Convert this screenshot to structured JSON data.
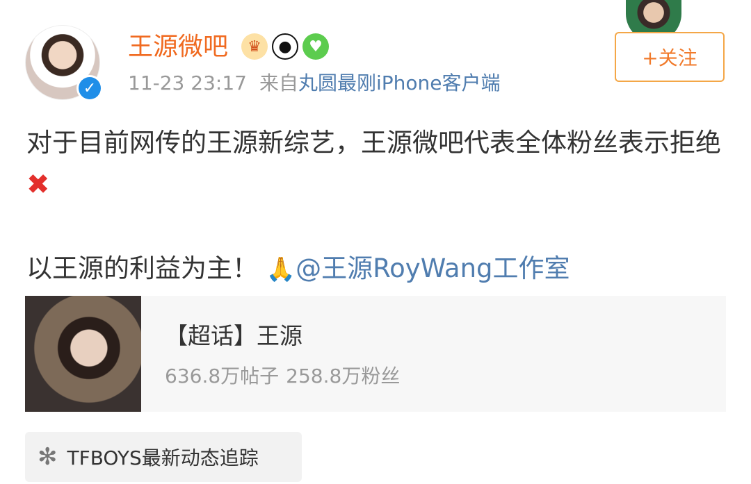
{
  "user": {
    "name": "王源微吧",
    "verified_icon": "verified-check-icon",
    "badge_icons": [
      "crown-icon",
      "panda-icon",
      "heart-icon"
    ]
  },
  "meta": {
    "time": "11-23 23:17",
    "source_prefix": "来自",
    "source_name": "丸圆最刚iPhone客户端"
  },
  "follow_button": {
    "label": "+关注"
  },
  "post": {
    "line1": "对于目前网传的王源新综艺，王源微吧代表全体粉丝表示拒绝",
    "x_mark": "✖",
    "line2_text": "以王源的利益为主！",
    "hands_icon": "🙏",
    "mention": "@王源RoyWang工作室"
  },
  "topic_card": {
    "title": "【超话】王源",
    "posts": "636.8万帖子",
    "fans": "258.8万粉丝"
  },
  "footer_tag": {
    "icon": "dots-loader-icon",
    "label": "TFBOYS最新动态追踪"
  },
  "colors": {
    "username": "#f06a20",
    "link": "#507daf",
    "follow_border": "#f4a747",
    "follow_text": "#f17a2b",
    "meta_text": "#999999",
    "verified": "#1f8ee8",
    "x_mark": "#e32f2b"
  }
}
